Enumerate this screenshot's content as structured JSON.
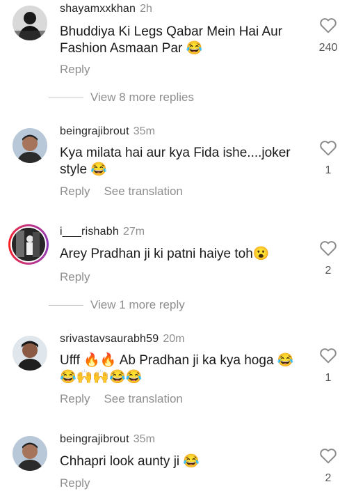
{
  "comments": [
    {
      "username": "shayamxxkhan",
      "time": "2h",
      "text": "Bhuddiya Ki Legs Qabar Mein Hai Aur Fashion Asmaan Par 😂",
      "likes": "240",
      "reply": "Reply",
      "translate": ""
    },
    {
      "username": "beingrajibrout",
      "time": "35m",
      "text": "Kya milata hai aur kya Fida ishe....joker style 😂",
      "likes": "1",
      "reply": "Reply",
      "translate": "See translation"
    },
    {
      "username": "i___rishabh",
      "time": "27m",
      "text": "Arey Pradhan ji ki patni haiye toh😮",
      "likes": "2",
      "reply": "Reply",
      "translate": ""
    },
    {
      "username": "srivastavsaurabh59",
      "time": "20m",
      "text": "Ufff 🔥🔥 Ab Pradhan ji ka kya hoga 😂😂🙌🙌😂😂",
      "likes": "1",
      "reply": "Reply",
      "translate": "See translation"
    },
    {
      "username": "beingrajibrout",
      "time": "35m",
      "text": "Chhapri look aunty ji 😂",
      "likes": "2",
      "reply": "Reply",
      "translate": ""
    }
  ],
  "view_replies": [
    {
      "label": "View 8 more replies"
    },
    {
      "label": "View 1 more reply"
    }
  ],
  "icons": {
    "like": "heart-outline-icon"
  },
  "colors": {
    "meta": "#8e8e8e",
    "text": "#1a1a1a"
  }
}
